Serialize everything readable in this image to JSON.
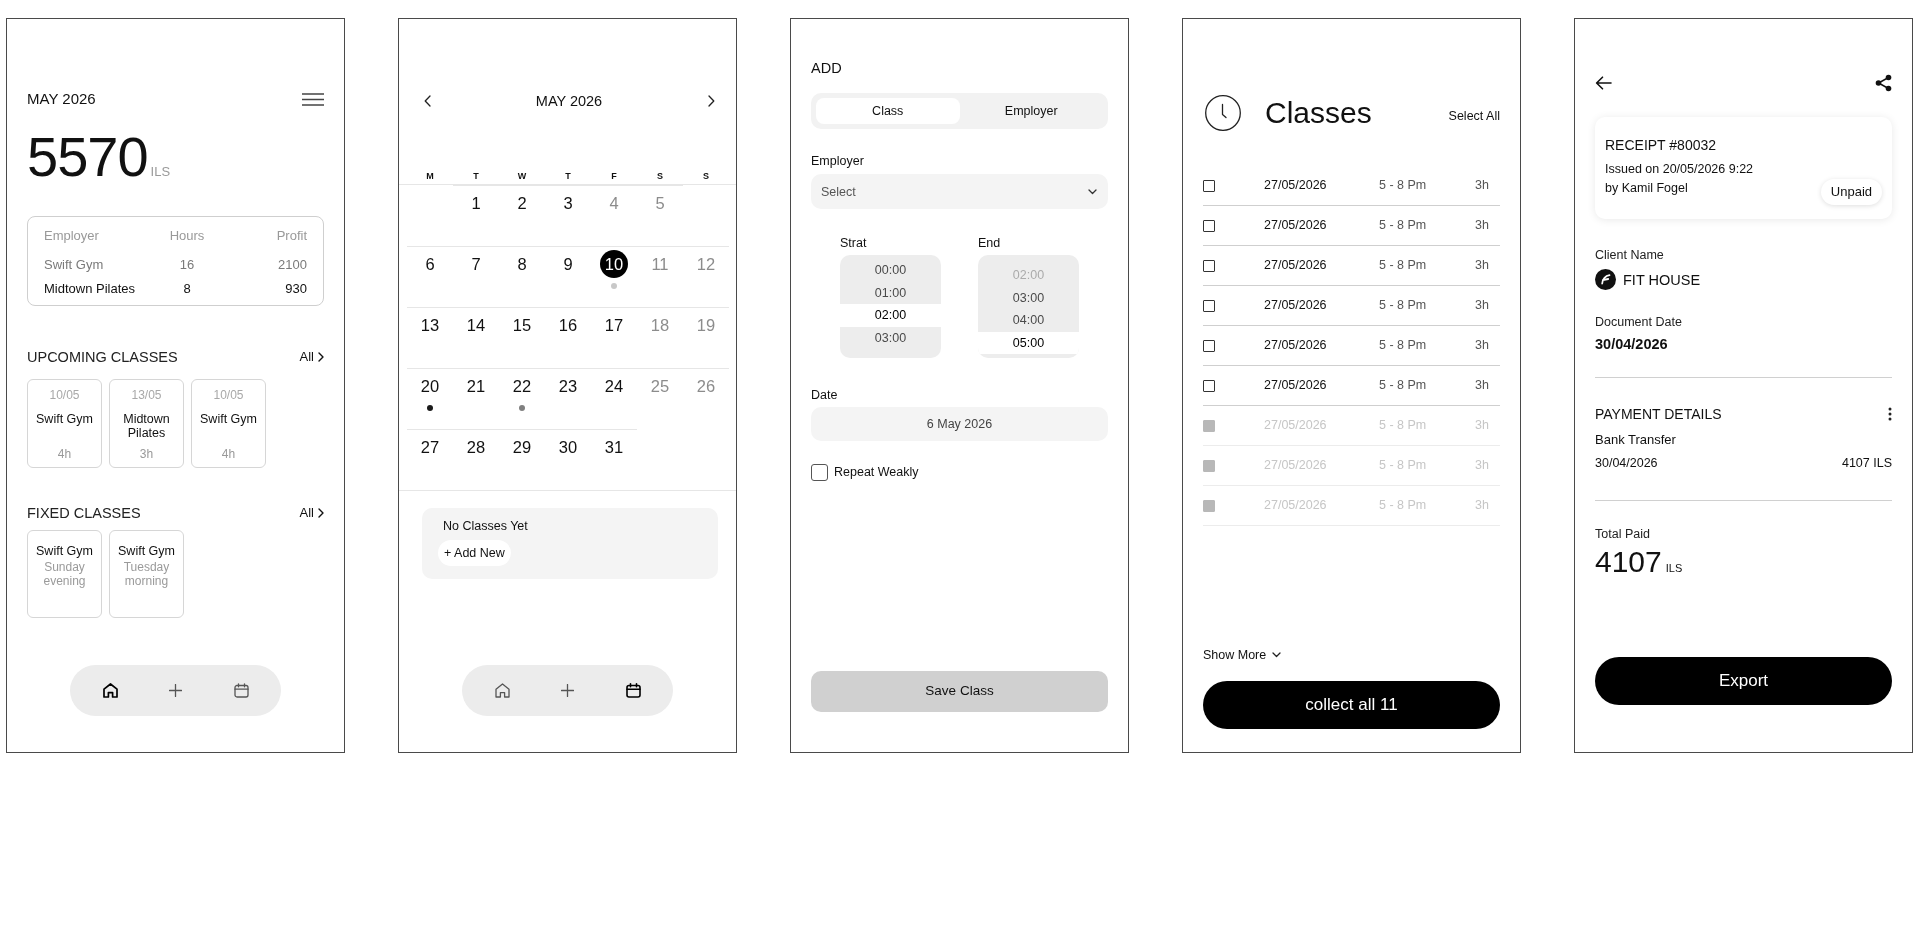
{
  "home": {
    "month": "MAY 2026",
    "total": "5570",
    "currency": "ILS",
    "summary": {
      "columns": [
        "Employer",
        "Hours",
        "Profit"
      ],
      "rows": [
        {
          "cells": [
            "Swift Gym",
            "16",
            "2100"
          ],
          "muted": true
        },
        {
          "cells": [
            "Midtown Pilates",
            "8",
            "930"
          ],
          "muted": false
        }
      ]
    },
    "upcoming": {
      "title": "UPCOMING CLASSES",
      "link": "All",
      "cards": [
        {
          "date": "10/05",
          "name": "Swift Gym",
          "duration": "4h"
        },
        {
          "date": "13/05",
          "name": "Midtown Pilates",
          "duration": "3h"
        },
        {
          "date": "10/05",
          "name": "Swift Gym",
          "duration": "4h"
        }
      ]
    },
    "fixed": {
      "title": "FIXED CLASSES",
      "link": "All",
      "cards": [
        {
          "name": "Swift Gym",
          "schedule": "Sunday evening"
        },
        {
          "name": "Swift Gym",
          "schedule": "Tuesday morning"
        }
      ]
    },
    "nav": [
      {
        "kind": "home",
        "selected": true
      },
      {
        "kind": "add",
        "selected": false
      },
      {
        "kind": "calendar",
        "selected": false
      }
    ]
  },
  "calendar": {
    "month": "MAY 2026",
    "weekdays": [
      "M",
      "T",
      "W",
      "T",
      "F",
      "S",
      "S"
    ],
    "weeks": [
      [
        {
          "kind": "blank"
        },
        {
          "kind": "day",
          "day": "1",
          "selected": false,
          "muted": false
        },
        {
          "kind": "day",
          "day": "2",
          "selected": false,
          "muted": false
        },
        {
          "kind": "day",
          "day": "3",
          "selected": false,
          "muted": false
        },
        {
          "kind": "day",
          "day": "4",
          "selected": false,
          "muted": true
        },
        {
          "kind": "day",
          "day": "5",
          "selected": false,
          "muted": true
        },
        {
          "kind": "blank"
        }
      ],
      [
        {
          "kind": "day",
          "day": "6",
          "selected": false,
          "muted": false
        },
        {
          "kind": "day",
          "day": "7",
          "selected": false,
          "muted": false
        },
        {
          "kind": "day",
          "day": "8",
          "selected": false,
          "muted": false
        },
        {
          "kind": "day",
          "day": "9",
          "selected": false,
          "muted": false
        },
        {
          "kind": "day",
          "day": "10",
          "selected": true,
          "muted": false,
          "color": "#c8c8c8"
        },
        {
          "kind": "day",
          "day": "11",
          "selected": false,
          "muted": true
        },
        {
          "kind": "day",
          "day": "12",
          "selected": false,
          "muted": true
        }
      ],
      [
        {
          "kind": "day",
          "day": "13",
          "selected": false,
          "muted": false
        },
        {
          "kind": "day",
          "day": "14",
          "selected": false,
          "muted": false
        },
        {
          "kind": "day",
          "day": "15",
          "selected": false,
          "muted": false
        },
        {
          "kind": "day",
          "day": "16",
          "selected": false,
          "muted": false
        },
        {
          "kind": "day",
          "day": "17",
          "selected": false,
          "muted": false
        },
        {
          "kind": "day",
          "day": "18",
          "selected": false,
          "muted": true
        },
        {
          "kind": "day",
          "day": "19",
          "selected": false,
          "muted": true
        }
      ],
      [
        {
          "kind": "day",
          "day": "20",
          "selected": false,
          "muted": false,
          "color": "#1a1a1a"
        },
        {
          "kind": "day",
          "day": "21",
          "selected": false,
          "muted": false
        },
        {
          "kind": "day",
          "day": "22",
          "selected": false,
          "muted": false,
          "color": "#808080"
        },
        {
          "kind": "day",
          "day": "23",
          "selected": false,
          "muted": false
        },
        {
          "kind": "day",
          "day": "24",
          "selected": false,
          "muted": false
        },
        {
          "kind": "day",
          "day": "25",
          "selected": false,
          "muted": true
        },
        {
          "kind": "day",
          "day": "26",
          "selected": false,
          "muted": true
        }
      ],
      [
        {
          "kind": "day",
          "day": "27",
          "selected": false,
          "muted": false
        },
        {
          "kind": "day",
          "day": "28",
          "selected": false,
          "muted": false
        },
        {
          "kind": "day",
          "day": "29",
          "selected": false,
          "muted": false
        },
        {
          "kind": "day",
          "day": "30",
          "selected": false,
          "muted": false
        },
        {
          "kind": "day",
          "day": "31",
          "selected": false,
          "muted": false
        },
        {
          "kind": "blank"
        },
        {
          "kind": "blank"
        }
      ]
    ],
    "empty_panel": {
      "message": "No Classes Yet",
      "action": "+ Add New"
    },
    "nav": [
      {
        "kind": "home",
        "selected": false
      },
      {
        "kind": "add",
        "selected": false
      },
      {
        "kind": "calendar",
        "selected": true
      }
    ]
  },
  "add_class": {
    "title": "ADD",
    "tabs": [
      {
        "label": "Class",
        "selected": true
      },
      {
        "label": "Employer",
        "selected": false
      }
    ],
    "employer": {
      "label": "Employer",
      "placeholder": "Select"
    },
    "start": {
      "label": "Strat",
      "options": [
        {
          "time": "00:00",
          "selected": false,
          "disabled": false
        },
        {
          "time": "01:00",
          "selected": false,
          "disabled": false
        },
        {
          "time": "02:00",
          "selected": true,
          "disabled": false
        },
        {
          "time": "03:00",
          "selected": false,
          "disabled": false
        }
      ]
    },
    "end": {
      "label": "End",
      "options": [
        {
          "time": "02:00",
          "selected": false,
          "disabled": true
        },
        {
          "time": "03:00",
          "selected": false,
          "disabled": false
        },
        {
          "time": "04:00",
          "selected": false,
          "disabled": false
        },
        {
          "time": "05:00",
          "selected": true,
          "disabled": false
        }
      ]
    },
    "date": {
      "label": "Date",
      "value": "6 May 2026"
    },
    "repeat": {
      "label": "Repeat Weakly",
      "checked": false
    },
    "save": {
      "label": "Save Class",
      "disabled": true
    }
  },
  "classes": {
    "title": "Classes",
    "select_all": "Select All",
    "rows": [
      {
        "date": "27/05/2026",
        "time": "5 - 8 Pm",
        "duration": "3h",
        "checked": false,
        "disabled": false
      },
      {
        "date": "27/05/2026",
        "time": "5 - 8 Pm",
        "duration": "3h",
        "checked": false,
        "disabled": false
      },
      {
        "date": "27/05/2026",
        "time": "5 - 8 Pm",
        "duration": "3h",
        "checked": false,
        "disabled": false
      },
      {
        "date": "27/05/2026",
        "time": "5 - 8 Pm",
        "duration": "3h",
        "checked": false,
        "disabled": false
      },
      {
        "date": "27/05/2026",
        "time": "5 - 8 Pm",
        "duration": "3h",
        "checked": false,
        "disabled": false
      },
      {
        "date": "27/05/2026",
        "time": "5 - 8 Pm",
        "duration": "3h",
        "checked": false,
        "disabled": false
      },
      {
        "date": "27/05/2026",
        "time": "5 - 8 Pm",
        "duration": "3h",
        "checked": false,
        "disabled": true
      },
      {
        "date": "27/05/2026",
        "time": "5 - 8 Pm",
        "duration": "3h",
        "checked": false,
        "disabled": true
      },
      {
        "date": "27/05/2026",
        "time": "5 - 8 Pm",
        "duration": "3h",
        "checked": false,
        "disabled": true
      }
    ],
    "show_more": "Show More",
    "collect": "collect all 11"
  },
  "receipt": {
    "card": {
      "title": "RECEIPT #80032",
      "issued": "Issued on 20/05/2026 9:22",
      "by": "by Kamil Fogel",
      "status": "Unpaid"
    },
    "client_label": "Client Name",
    "client": "FIT HOUSE",
    "document_date_label": "Document Date",
    "document_date": "30/04/2026",
    "payment": {
      "title": "PAYMENT DETAILS",
      "method": "Bank Transfer",
      "date": "30/04/2026",
      "amount": "4107 ILS"
    },
    "total_label": "Total Paid",
    "total": "4107",
    "total_currency": "ILS",
    "export": "Export"
  }
}
